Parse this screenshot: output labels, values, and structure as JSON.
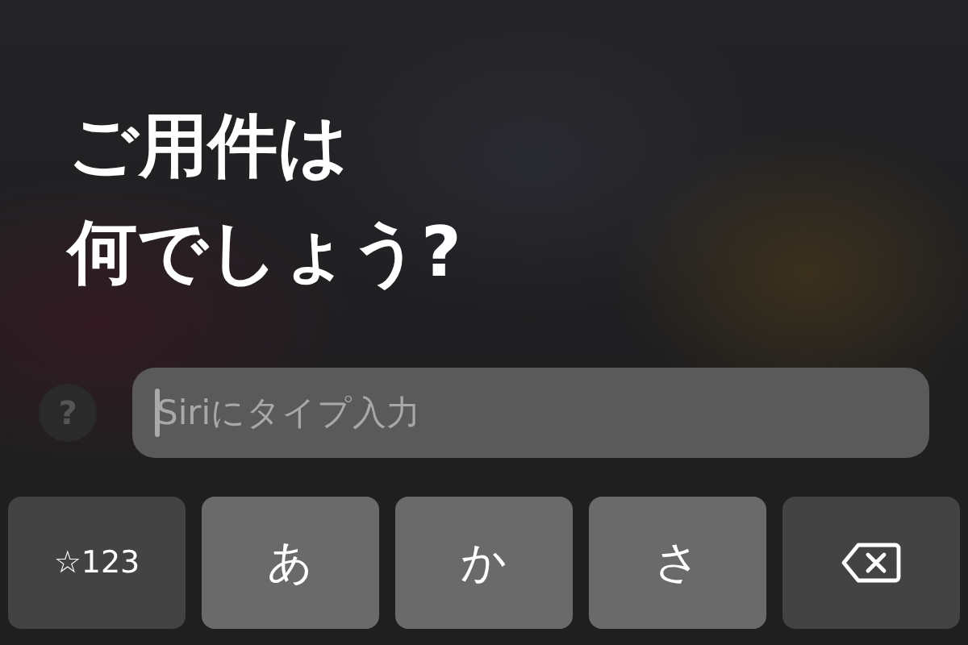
{
  "prompt": {
    "lines": [
      "ご用件は",
      "何でしょう?"
    ]
  },
  "help_button": {
    "label": "?"
  },
  "input": {
    "placeholder": "Siriにタイプ入力"
  },
  "keys": [
    {
      "kind": "function",
      "label": "☆123"
    },
    {
      "kind": "letter",
      "label": "あ"
    },
    {
      "kind": "letter",
      "label": "か"
    },
    {
      "kind": "letter",
      "label": "さ"
    },
    {
      "kind": "delete"
    }
  ]
}
